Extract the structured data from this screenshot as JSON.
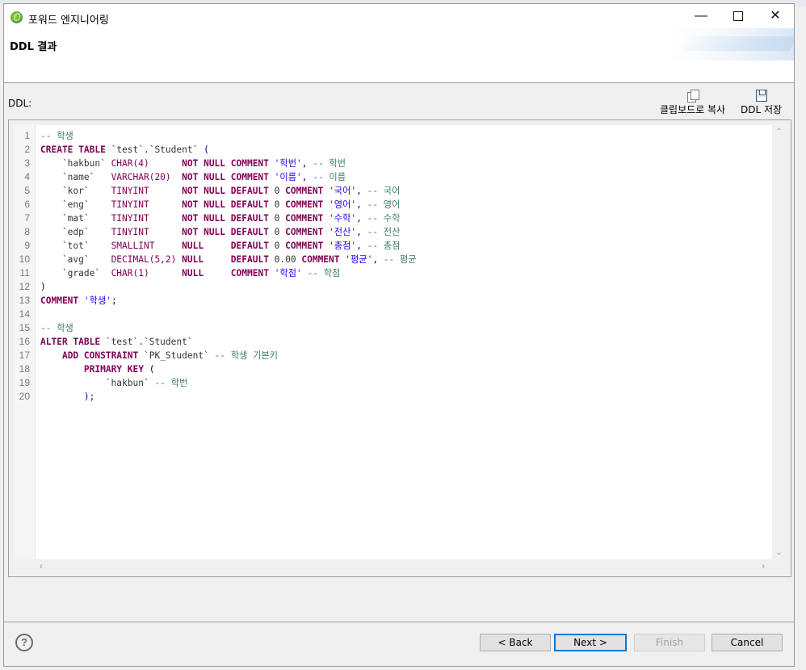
{
  "window": {
    "title": "포워드 엔지니어링"
  },
  "header": {
    "title": "DDL 결과"
  },
  "ddl_label": "DDL:",
  "toolbar": {
    "copy_label": "클립보드로 복사",
    "save_label": "DDL 저장"
  },
  "code_lines": [
    {
      "n": "1",
      "seg": [
        {
          "t": "-- 학생",
          "c": "cm"
        }
      ]
    },
    {
      "n": "2",
      "seg": [
        {
          "t": "CREATE TABLE",
          "c": "kw"
        },
        {
          "t": " `test`.`Student` ",
          "c": "nm"
        },
        {
          "t": "(",
          "c": "pn"
        }
      ]
    },
    {
      "n": "3",
      "seg": [
        {
          "t": "    `hakbun` ",
          "c": "nm"
        },
        {
          "t": "CHAR(4)",
          "c": "ty"
        },
        {
          "t": "      ",
          "c": "nm"
        },
        {
          "t": "NOT NULL COMMENT",
          "c": "kw"
        },
        {
          "t": " ",
          "c": "nm"
        },
        {
          "t": "'학번'",
          "c": "str"
        },
        {
          "t": ", ",
          "c": "pn"
        },
        {
          "t": "-- 학번",
          "c": "cm"
        }
      ]
    },
    {
      "n": "4",
      "seg": [
        {
          "t": "    `name`   ",
          "c": "nm"
        },
        {
          "t": "VARCHAR(20)",
          "c": "ty"
        },
        {
          "t": "  ",
          "c": "nm"
        },
        {
          "t": "NOT NULL COMMENT",
          "c": "kw"
        },
        {
          "t": " ",
          "c": "nm"
        },
        {
          "t": "'이름'",
          "c": "str"
        },
        {
          "t": ", ",
          "c": "pn"
        },
        {
          "t": "-- 이름",
          "c": "cm"
        }
      ]
    },
    {
      "n": "5",
      "seg": [
        {
          "t": "    `kor`    ",
          "c": "nm"
        },
        {
          "t": "TINYINT",
          "c": "ty"
        },
        {
          "t": "      ",
          "c": "nm"
        },
        {
          "t": "NOT NULL DEFAULT",
          "c": "kw"
        },
        {
          "t": " 0 ",
          "c": "nm"
        },
        {
          "t": "COMMENT",
          "c": "kw"
        },
        {
          "t": " ",
          "c": "nm"
        },
        {
          "t": "'국어'",
          "c": "str"
        },
        {
          "t": ", ",
          "c": "pn"
        },
        {
          "t": "-- 국어",
          "c": "cm"
        }
      ]
    },
    {
      "n": "6",
      "seg": [
        {
          "t": "    `eng`    ",
          "c": "nm"
        },
        {
          "t": "TINYINT",
          "c": "ty"
        },
        {
          "t": "      ",
          "c": "nm"
        },
        {
          "t": "NOT NULL DEFAULT",
          "c": "kw"
        },
        {
          "t": " 0 ",
          "c": "nm"
        },
        {
          "t": "COMMENT",
          "c": "kw"
        },
        {
          "t": " ",
          "c": "nm"
        },
        {
          "t": "'영어'",
          "c": "str"
        },
        {
          "t": ", ",
          "c": "pn"
        },
        {
          "t": "-- 영어",
          "c": "cm"
        }
      ]
    },
    {
      "n": "7",
      "seg": [
        {
          "t": "    `mat`    ",
          "c": "nm"
        },
        {
          "t": "TINYINT",
          "c": "ty"
        },
        {
          "t": "      ",
          "c": "nm"
        },
        {
          "t": "NOT NULL DEFAULT",
          "c": "kw"
        },
        {
          "t": " 0 ",
          "c": "nm"
        },
        {
          "t": "COMMENT",
          "c": "kw"
        },
        {
          "t": " ",
          "c": "nm"
        },
        {
          "t": "'수학'",
          "c": "str"
        },
        {
          "t": ", ",
          "c": "pn"
        },
        {
          "t": "-- 수학",
          "c": "cm"
        }
      ]
    },
    {
      "n": "8",
      "seg": [
        {
          "t": "    `edp`    ",
          "c": "nm"
        },
        {
          "t": "TINYINT",
          "c": "ty"
        },
        {
          "t": "      ",
          "c": "nm"
        },
        {
          "t": "NOT NULL DEFAULT",
          "c": "kw"
        },
        {
          "t": " 0 ",
          "c": "nm"
        },
        {
          "t": "COMMENT",
          "c": "kw"
        },
        {
          "t": " ",
          "c": "nm"
        },
        {
          "t": "'전산'",
          "c": "str"
        },
        {
          "t": ", ",
          "c": "pn"
        },
        {
          "t": "-- 전산",
          "c": "cm"
        }
      ]
    },
    {
      "n": "9",
      "seg": [
        {
          "t": "    `tot`    ",
          "c": "nm"
        },
        {
          "t": "SMALLINT",
          "c": "ty"
        },
        {
          "t": "     ",
          "c": "nm"
        },
        {
          "t": "NULL",
          "c": "kw"
        },
        {
          "t": "     ",
          "c": "nm"
        },
        {
          "t": "DEFAULT",
          "c": "kw"
        },
        {
          "t": " 0 ",
          "c": "nm"
        },
        {
          "t": "COMMENT",
          "c": "kw"
        },
        {
          "t": " ",
          "c": "nm"
        },
        {
          "t": "'총점'",
          "c": "str"
        },
        {
          "t": ", ",
          "c": "pn"
        },
        {
          "t": "-- 총점",
          "c": "cm"
        }
      ]
    },
    {
      "n": "10",
      "seg": [
        {
          "t": "    `avg`    ",
          "c": "nm"
        },
        {
          "t": "DECIMAL(5,2)",
          "c": "ty"
        },
        {
          "t": " ",
          "c": "nm"
        },
        {
          "t": "NULL",
          "c": "kw"
        },
        {
          "t": "     ",
          "c": "nm"
        },
        {
          "t": "DEFAULT",
          "c": "kw"
        },
        {
          "t": " 0.00 ",
          "c": "nm"
        },
        {
          "t": "COMMENT",
          "c": "kw"
        },
        {
          "t": " ",
          "c": "nm"
        },
        {
          "t": "'평균'",
          "c": "str"
        },
        {
          "t": ", ",
          "c": "pn"
        },
        {
          "t": "-- 평균",
          "c": "cm"
        }
      ]
    },
    {
      "n": "11",
      "seg": [
        {
          "t": "    `grade`  ",
          "c": "nm"
        },
        {
          "t": "CHAR(1)",
          "c": "ty"
        },
        {
          "t": "      ",
          "c": "nm"
        },
        {
          "t": "NULL",
          "c": "kw"
        },
        {
          "t": "     ",
          "c": "nm"
        },
        {
          "t": "COMMENT",
          "c": "kw"
        },
        {
          "t": " ",
          "c": "nm"
        },
        {
          "t": "'학점'",
          "c": "str"
        },
        {
          "t": " ",
          "c": "nm"
        },
        {
          "t": "-- 학점",
          "c": "cm"
        }
      ]
    },
    {
      "n": "12",
      "seg": [
        {
          "t": ")",
          "c": "pn"
        }
      ]
    },
    {
      "n": "13",
      "seg": [
        {
          "t": "COMMENT",
          "c": "kw"
        },
        {
          "t": " ",
          "c": "nm"
        },
        {
          "t": "'학생'",
          "c": "str"
        },
        {
          "t": ";",
          "c": "pn"
        }
      ]
    },
    {
      "n": "14",
      "seg": []
    },
    {
      "n": "15",
      "seg": [
        {
          "t": "-- 학생",
          "c": "cm"
        }
      ]
    },
    {
      "n": "16",
      "seg": [
        {
          "t": "ALTER TABLE",
          "c": "kw"
        },
        {
          "t": " `test`.`Student`",
          "c": "nm"
        }
      ]
    },
    {
      "n": "17",
      "seg": [
        {
          "t": "    ",
          "c": "nm"
        },
        {
          "t": "ADD CONSTRAINT",
          "c": "kw"
        },
        {
          "t": " `PK_Student` ",
          "c": "nm"
        },
        {
          "t": "-- 학생 기본키",
          "c": "cm"
        }
      ]
    },
    {
      "n": "18",
      "seg": [
        {
          "t": "        ",
          "c": "nm"
        },
        {
          "t": "PRIMARY KEY",
          "c": "kw"
        },
        {
          "t": " ",
          "c": "nm"
        },
        {
          "t": "(",
          "c": "pn"
        }
      ]
    },
    {
      "n": "19",
      "seg": [
        {
          "t": "            `hakbun` ",
          "c": "nm"
        },
        {
          "t": "-- 학번",
          "c": "cm"
        }
      ]
    },
    {
      "n": "20",
      "seg": [
        {
          "t": "        ",
          "c": "nm"
        },
        {
          "t": ");",
          "c": "pn"
        }
      ]
    }
  ],
  "buttons": {
    "back": "< Back",
    "next": "Next >",
    "finish": "Finish",
    "cancel": "Cancel",
    "help": "?"
  }
}
